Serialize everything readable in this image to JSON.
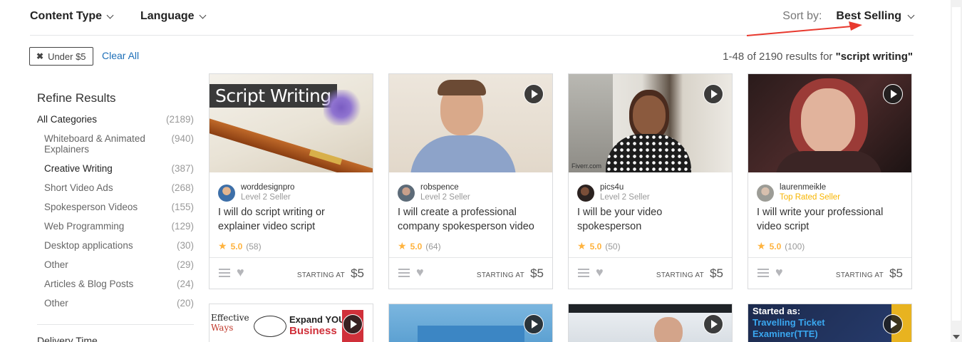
{
  "filters": {
    "content_type": "Content Type",
    "language": "Language",
    "sort_label": "Sort by:",
    "sort_value": "Best Selling"
  },
  "active_filter": {
    "chip_label": "Under $5",
    "clear_all": "Clear All"
  },
  "results": {
    "prefix": "1-48 of 2190 results for",
    "query": "\"script writing\""
  },
  "sidebar": {
    "title": "Refine Results",
    "all": {
      "label": "All Categories",
      "count": "(2189)"
    },
    "categories": [
      {
        "label": "Whiteboard & Animated Explainers",
        "count": "(940)"
      },
      {
        "label": "Creative Writing",
        "count": "(387)"
      },
      {
        "label": "Short Video Ads",
        "count": "(268)"
      },
      {
        "label": "Spokesperson Videos",
        "count": "(155)"
      },
      {
        "label": "Web Programming",
        "count": "(129)"
      },
      {
        "label": "Desktop applications",
        "count": "(30)"
      },
      {
        "label": "Other",
        "count": "(29)"
      },
      {
        "label": "Articles & Blog Posts",
        "count": "(24)"
      },
      {
        "label": "Other",
        "count": "(20)"
      }
    ],
    "delivery_time": "Delivery Time"
  },
  "gigs": [
    {
      "thumb_text": "Script Writing",
      "seller": "worddesignpro",
      "level": "Level 2 Seller",
      "title": "I will do script writing or explainer video script",
      "rating": "5.0",
      "reviews": "(58)",
      "starting_label": "STARTING AT",
      "price": "$5"
    },
    {
      "seller": "robspence",
      "level": "Level 2 Seller",
      "title": "I will create a professional company spokesperson video",
      "rating": "5.0",
      "reviews": "(64)",
      "starting_label": "STARTING AT",
      "price": "$5"
    },
    {
      "thumb_caption": "Fiverr.com",
      "seller": "pics4u",
      "level": "Level 2 Seller",
      "title": "I will be your video spokesperson",
      "rating": "5.0",
      "reviews": "(50)",
      "starting_label": "STARTING AT",
      "price": "$5"
    },
    {
      "seller": "laurenmeikle",
      "level": "Top Rated Seller",
      "title": "I will write your professional video script",
      "rating": "5.0",
      "reviews": "(100)",
      "starting_label": "STARTING AT",
      "price": "$5"
    }
  ],
  "row2": [
    {
      "text_a": "Effective",
      "text_b": "Ways",
      "text_c": "Expand YOUR",
      "text_d": "Business"
    },
    {},
    {},
    {
      "text_a": "Started as:",
      "text_b": "Travelling Ticket",
      "text_c": "Examiner(TTE)"
    }
  ],
  "colors": {
    "accent_link": "#1d6fb8",
    "star": "#ffb33e",
    "top_rated": "#f7b500",
    "arrow": "#e8392e"
  }
}
